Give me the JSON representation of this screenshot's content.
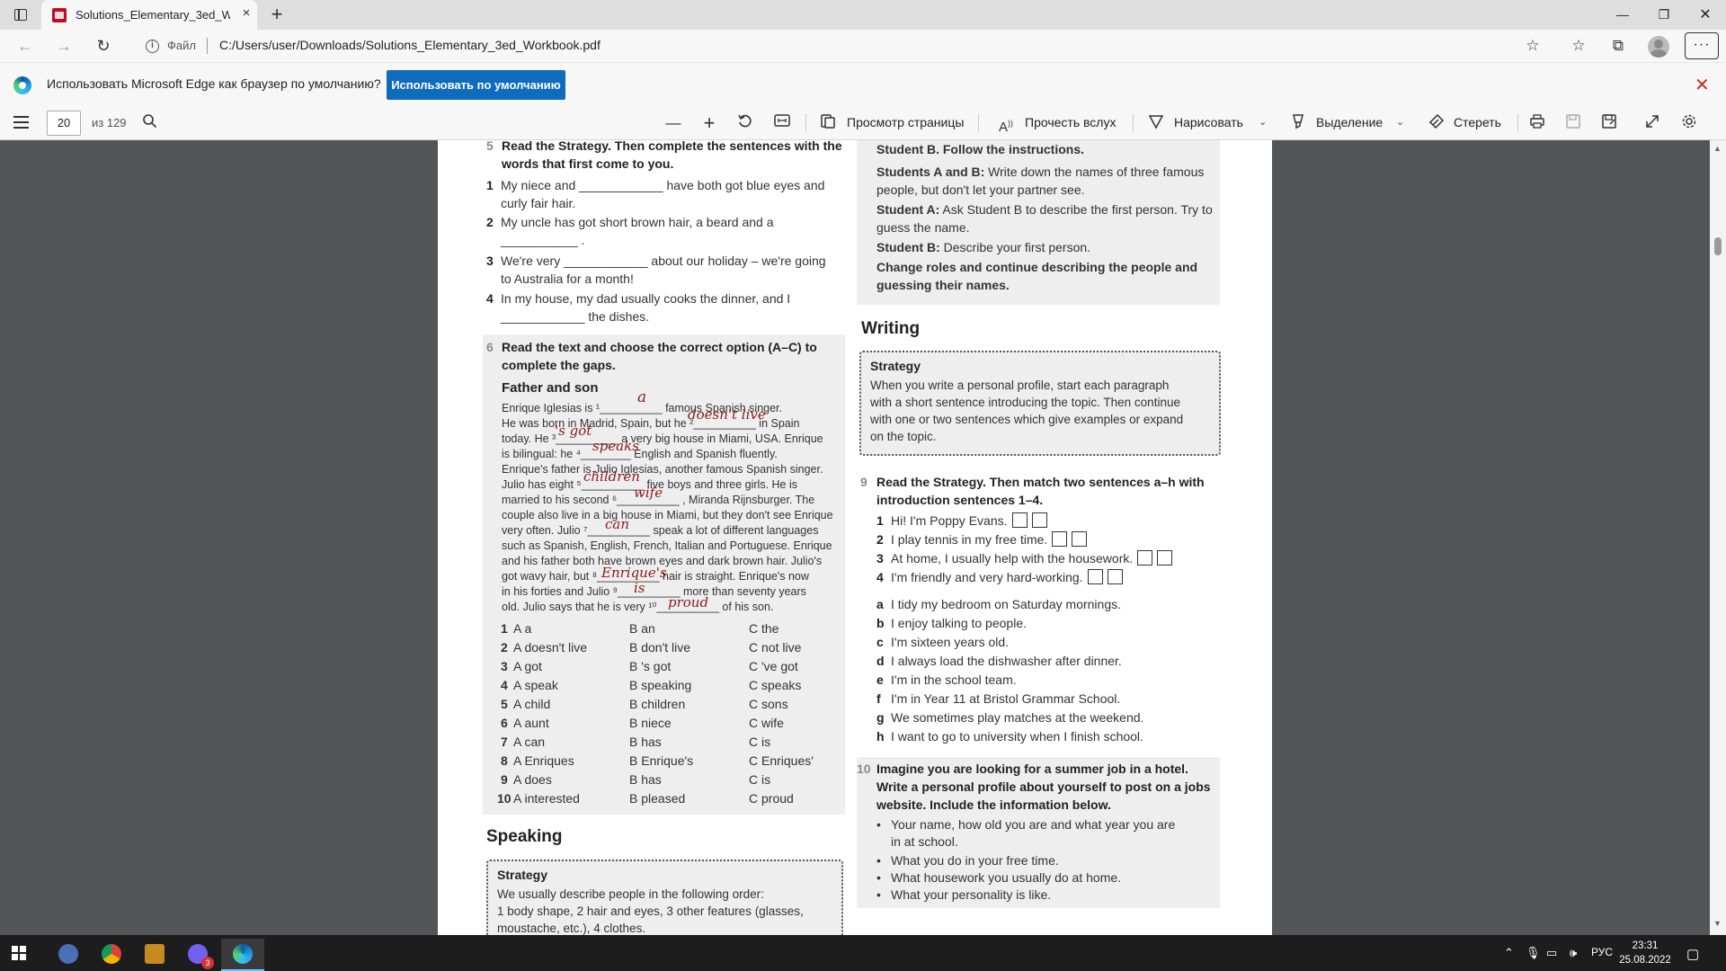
{
  "browser": {
    "tab_title": "Solutions_Elementary_3ed_Work",
    "tab_close": "×",
    "new_tab": "+",
    "window_buttons": {
      "minimize": "—",
      "maximize": "❐",
      "close": "✕"
    },
    "nav": {
      "back": "←",
      "forward": "→",
      "reload": "↻"
    },
    "address": {
      "info_icon": "i",
      "scheme_label": "Файл",
      "url": "C:/Users/user/Downloads/Solutions_Elementary_3ed_Workbook.pdf"
    },
    "toolbar_icons": {
      "favorite_add": "☆",
      "favorites": "☆",
      "collections": "⧉",
      "more": "···"
    }
  },
  "infobar": {
    "message": "Использовать Microsoft Edge как браузер по умолчанию?",
    "button": "Использовать по умолчанию",
    "close": "✕"
  },
  "pdf_toolbar": {
    "page_current": "20",
    "page_total": "из 129",
    "zoom_out": "—",
    "zoom_in": "+",
    "page_view": "Просмотр страницы",
    "read_aloud": "Прочесть вслух",
    "draw": "Нарисовать",
    "highlight": "Выделение",
    "erase": "Стереть"
  },
  "doc": {
    "ex5": {
      "num": "5",
      "head": "Read the Strategy. Then complete the sentences with the words that first come to you.",
      "items": [
        {
          "n": "1",
          "t": "My niece and ____________ have both got blue eyes and curly fair hair."
        },
        {
          "n": "2",
          "t": "My uncle has got short brown hair, a beard and a ___________ ."
        },
        {
          "n": "3",
          "t": "We're very ____________ about our holiday – we're going to Australia for a month!"
        },
        {
          "n": "4",
          "t": "In my house, my dad usually cooks the dinner, and I ____________ the dishes."
        }
      ]
    },
    "ex6": {
      "num": "6",
      "head": "Read the text and choose the correct option (A–C) to complete the gaps.",
      "text_title": "Father and son",
      "text_lines": [
        "Enrique Iglesias is ¹__________ famous Spanish singer.",
        "He was born in Madrid, Spain, but he ²__________ in Spain",
        "today. He ³__________ a very big house in Miami, USA. Enrique",
        "is bilingual: he ⁴________ English and Spanish fluently.",
        "Enrique's father is Julio Iglesias, another famous Spanish singer.",
        "Julio has eight ⁵__________ five boys and three girls. He is",
        "married to his second ⁶__________ , Miranda Rijnsburger. The",
        "couple also live in a big house in Miami, but they don't see Enrique",
        "very often. Julio ⁷__________ speak a lot of different languages",
        "such as Spanish, English, French, Italian and Portuguese. Enrique",
        "and his father both have brown eyes and dark brown hair. Julio's",
        "got wavy hair, but ⁸__________ hair is straight. Enrique's now",
        "in his forties and Julio ⁹__________ more than seventy years",
        "old. Julio says that he is very ¹⁰__________ of his son."
      ],
      "handwriting": [
        "a",
        "doesn't live",
        "'s got",
        "speaks",
        "children",
        "wife",
        "can",
        "Enrique's",
        "is",
        "proud"
      ],
      "options": [
        {
          "n": "1",
          "a": "A  a",
          "b": "B  an",
          "c": "C  the"
        },
        {
          "n": "2",
          "a": "A  doesn't live",
          "b": "B  don't live",
          "c": "C  not live"
        },
        {
          "n": "3",
          "a": "A  got",
          "b": "B  's got",
          "c": "C  've got"
        },
        {
          "n": "4",
          "a": "A  speak",
          "b": "B  speaking",
          "c": "C  speaks"
        },
        {
          "n": "5",
          "a": "A  child",
          "b": "B  children",
          "c": "C  sons"
        },
        {
          "n": "6",
          "a": "A  aunt",
          "b": "B  niece",
          "c": "C  wife"
        },
        {
          "n": "7",
          "a": "A  can",
          "b": "B  has",
          "c": "C  is"
        },
        {
          "n": "8",
          "a": "A  Enriques",
          "b": "B  Enrique's",
          "c": "C  Enriques'"
        },
        {
          "n": "9",
          "a": "A  does",
          "b": "B  has",
          "c": "C  is"
        },
        {
          "n": "10",
          "a": "A  interested",
          "b": "B  pleased",
          "c": "C  proud"
        }
      ]
    },
    "speaking": {
      "title": "Speaking",
      "strategy_head": "Strategy",
      "strategy_lines": [
        "We usually describe people in the following order:",
        "1 body shape, 2 hair and eyes, 3 other features (glasses,",
        "moustache, etc.), 4 clothes."
      ]
    },
    "right_top": {
      "lines": [
        {
          "bold": "Student B. Follow the instructions.",
          "rest": ""
        },
        {
          "bold": "Students A and B:",
          "rest": " Write down the names of three famous people, but don't let your partner see."
        },
        {
          "bold": "Student A:",
          "rest": " Ask Student B to describe the first person. Try to guess the name."
        },
        {
          "bold": "Student B:",
          "rest": " Describe your first person."
        },
        {
          "bold": "Change roles and continue describing the people and guessing their names.",
          "rest": ""
        }
      ]
    },
    "writing": {
      "title": "Writing",
      "strategy_head": "Strategy",
      "strategy_lines": [
        "When you write a personal profile, start each paragraph",
        "with a short sentence introducing the topic. Then continue",
        "with one or two sentences which give examples or expand",
        "on the topic."
      ]
    },
    "ex9": {
      "num": "9",
      "head": "Read the Strategy. Then match two sentences a–h with introduction sentences 1–4.",
      "intro": [
        {
          "n": "1",
          "t": "Hi! I'm Poppy Evans."
        },
        {
          "n": "2",
          "t": "I play tennis in my free time."
        },
        {
          "n": "3",
          "t": "At home, I usually help with the housework."
        },
        {
          "n": "4",
          "t": "I'm friendly and very hard-working."
        }
      ],
      "sentences": [
        {
          "l": "a",
          "t": "I tidy my bedroom on Saturday mornings."
        },
        {
          "l": "b",
          "t": "I enjoy talking to people."
        },
        {
          "l": "c",
          "t": "I'm sixteen years old."
        },
        {
          "l": "d",
          "t": "I always load the dishwasher after dinner."
        },
        {
          "l": "e",
          "t": "I'm in the school team."
        },
        {
          "l": "f",
          "t": "I'm in Year 11 at Bristol Grammar School."
        },
        {
          "l": "g",
          "t": "We sometimes play matches at the weekend."
        },
        {
          "l": "h",
          "t": "I want to go to university when I finish school."
        }
      ]
    },
    "ex10": {
      "num": "10",
      "head": "Imagine you are looking for a summer job in a hotel. Write a personal profile about yourself to post on a jobs website. Include the information below.",
      "bullets": [
        "Your name, how old you are and what year you are in at school.",
        "What you do in your free time.",
        "What housework you usually do at home.",
        "What your personality is like."
      ]
    }
  },
  "taskbar": {
    "lang": "РУС",
    "time": "23:31",
    "date": "25.08.2022",
    "badge": "3"
  }
}
